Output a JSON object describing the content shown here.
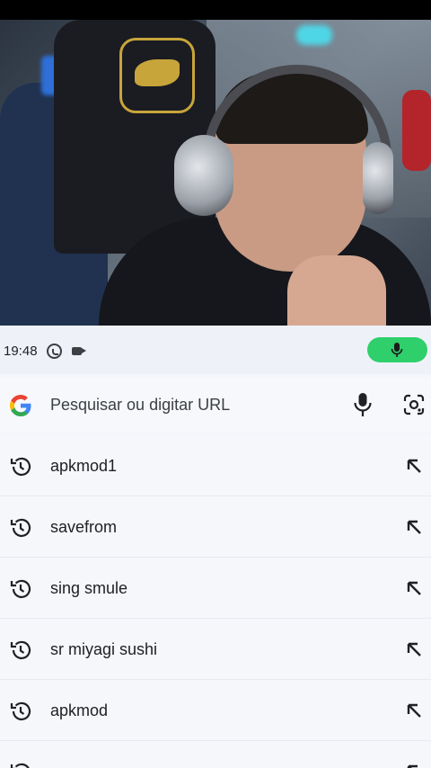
{
  "statusbar": {
    "time": "19:48"
  },
  "search": {
    "placeholder": "Pesquisar ou digitar URL"
  },
  "suggestions": [
    {
      "label": "apkmod1"
    },
    {
      "label": "savefrom"
    },
    {
      "label": "sing smule"
    },
    {
      "label": "sr miyagi sushi"
    },
    {
      "label": "apkmod"
    },
    {
      "label": ""
    }
  ],
  "colors": {
    "mic_pill": "#2fcf6b",
    "sheet_bg": "#f4f6fb"
  },
  "icons": [
    "whatsapp-icon",
    "video-camera-icon",
    "mic-icon",
    "google-logo",
    "google-lens-icon",
    "history-icon",
    "fill-arrow-icon"
  ]
}
